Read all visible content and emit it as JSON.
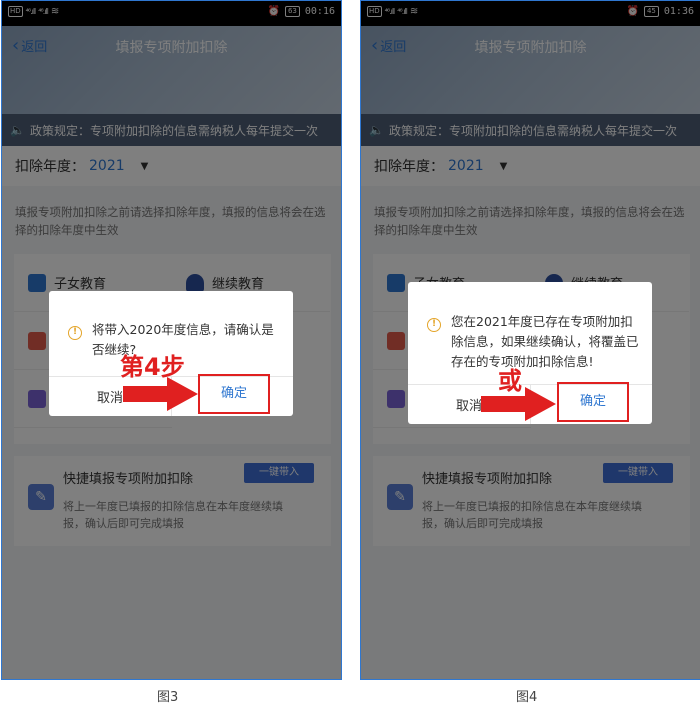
{
  "left": {
    "statusbar": {
      "hd": "HD",
      "sig1": "⁴⁶.ıll",
      "sig2": "⁴⁶.ıll",
      "battery": "63",
      "time": "00:16"
    },
    "header": {
      "back": "返回",
      "title": "填报专项附加扣除"
    },
    "policy": "政策规定：专项附加扣除的信息需纳税人每年提交一次",
    "year": {
      "label": "扣除年度：",
      "value": "2021"
    },
    "hint": "填报专项附加扣除之前请选择扣除年度，填报的信息将会在选择的扣除年度中生效",
    "cards": [
      "子女教育",
      "继续教育"
    ],
    "quick": {
      "title": "快捷填报专项附加扣除",
      "button": "一键带入",
      "desc": "将上一年度已填报的扣除信息在本年度继续填报，确认后即可完成填报"
    },
    "dialog": {
      "message": "将带入2020年度信息，请确认是否继续?",
      "cancel": "取消",
      "confirm": "确定"
    },
    "step_label": "第4步",
    "caption": "图3"
  },
  "right": {
    "statusbar": {
      "hd": "HD",
      "sig1": "⁴⁶.ıll",
      "sig2": "⁴⁶.ıll",
      "battery": "45",
      "time": "01:36"
    },
    "header": {
      "back": "返回",
      "title": "填报专项附加扣除"
    },
    "policy": "政策规定：专项附加扣除的信息需纳税人每年提交一次",
    "year": {
      "label": "扣除年度：",
      "value": "2021"
    },
    "hint": "填报专项附加扣除之前请选择扣除年度，填报的信息将会在选择的扣除年度中生效",
    "cards": [
      "子女教育",
      "继续教育"
    ],
    "quick": {
      "title": "快捷填报专项附加扣除",
      "button": "一键带入",
      "desc": "将上一年度已填报的扣除信息在本年度继续填报，确认后即可完成填报"
    },
    "dialog": {
      "message": "您在2021年度已存在专项附加扣除信息，如果继续确认，将覆盖已存在的专项附加扣除信息!",
      "cancel": "取消",
      "confirm": "确定"
    },
    "step_label": "或",
    "caption": "图4"
  },
  "colors": {
    "accent": "#2f77d0",
    "highlight": "#e02020",
    "warning": "#e4a52a"
  },
  "icons": [
    "back-chevron-icon",
    "speaker-icon",
    "caret-down-icon",
    "warning-icon",
    "arrow-right-icon",
    "alarm-icon",
    "wifi-icon"
  ]
}
